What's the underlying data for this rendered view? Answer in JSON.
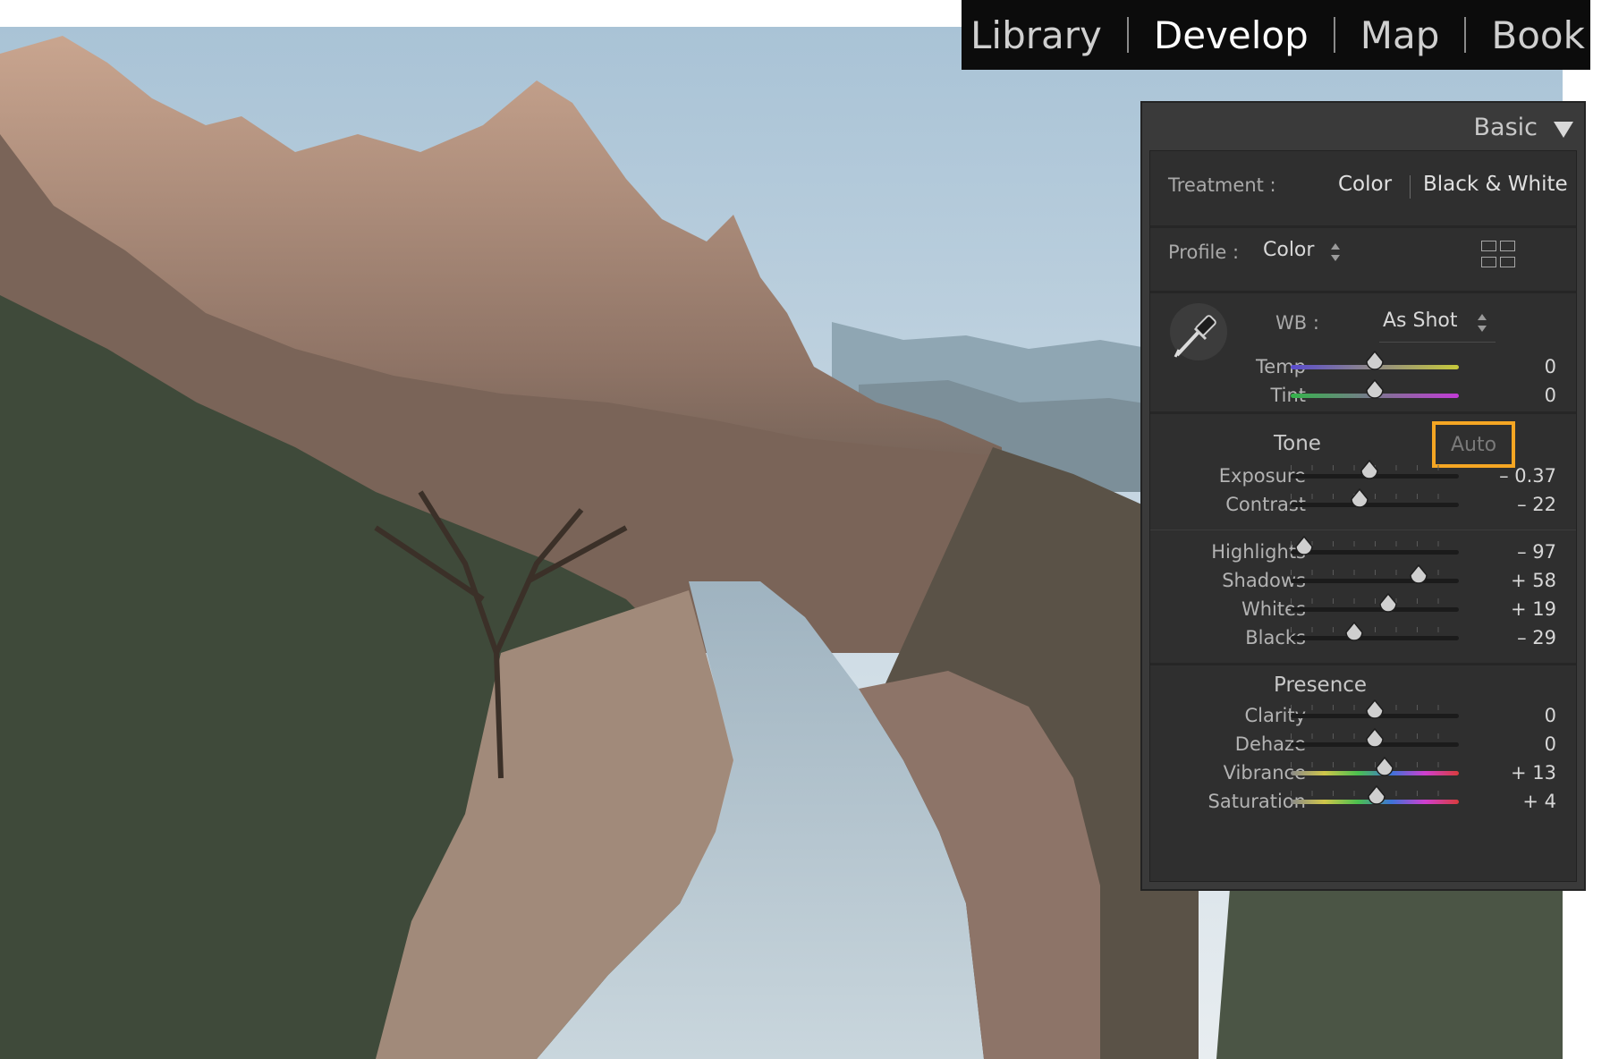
{
  "modules": {
    "library": "Library",
    "develop": "Develop",
    "map": "Map",
    "book": "Book",
    "active": "develop"
  },
  "panel": {
    "title": "Basic",
    "treatment": {
      "label": "Treatment :",
      "color": "Color",
      "bw": "Black & White",
      "selected": "color"
    },
    "profile": {
      "label": "Profile :",
      "value": "Color"
    },
    "wb": {
      "label": "WB :",
      "value": "As Shot"
    },
    "tone": {
      "title": "Tone",
      "auto": "Auto"
    },
    "presence": {
      "title": "Presence"
    },
    "sliders": {
      "temp": {
        "label": "Temp",
        "value": "0",
        "pos": 0.5
      },
      "tint": {
        "label": "Tint",
        "value": "0",
        "pos": 0.5
      },
      "exposure": {
        "label": "Exposure",
        "value": "– 0.37",
        "pos": 0.47
      },
      "contrast": {
        "label": "Contrast",
        "value": "– 22",
        "pos": 0.41
      },
      "highlights": {
        "label": "Highlights",
        "value": "– 97",
        "pos": 0.08
      },
      "shadows": {
        "label": "Shadows",
        "value": "+ 58",
        "pos": 0.76
      },
      "whites": {
        "label": "Whites",
        "value": "+ 19",
        "pos": 0.58
      },
      "blacks": {
        "label": "Blacks",
        "value": "– 29",
        "pos": 0.38
      },
      "clarity": {
        "label": "Clarity",
        "value": "0",
        "pos": 0.5
      },
      "dehaze": {
        "label": "Dehaze",
        "value": "0",
        "pos": 0.5
      },
      "vibrance": {
        "label": "Vibrance",
        "value": "+ 13",
        "pos": 0.56
      },
      "saturation": {
        "label": "Saturation",
        "value": "+ 4",
        "pos": 0.51
      }
    }
  },
  "colors": {
    "auto_highlight": "#f5a623",
    "temp_gradient": [
      "#5a4ccf",
      "#c7c93a"
    ],
    "tint_gradient": [
      "#35b34a",
      "#c23bd6"
    ],
    "color_gradient": [
      "#8a8a8a",
      "#d0c64a",
      "#4bc04f",
      "#3d73d9",
      "#cf3fcf",
      "#d93c3c"
    ]
  }
}
